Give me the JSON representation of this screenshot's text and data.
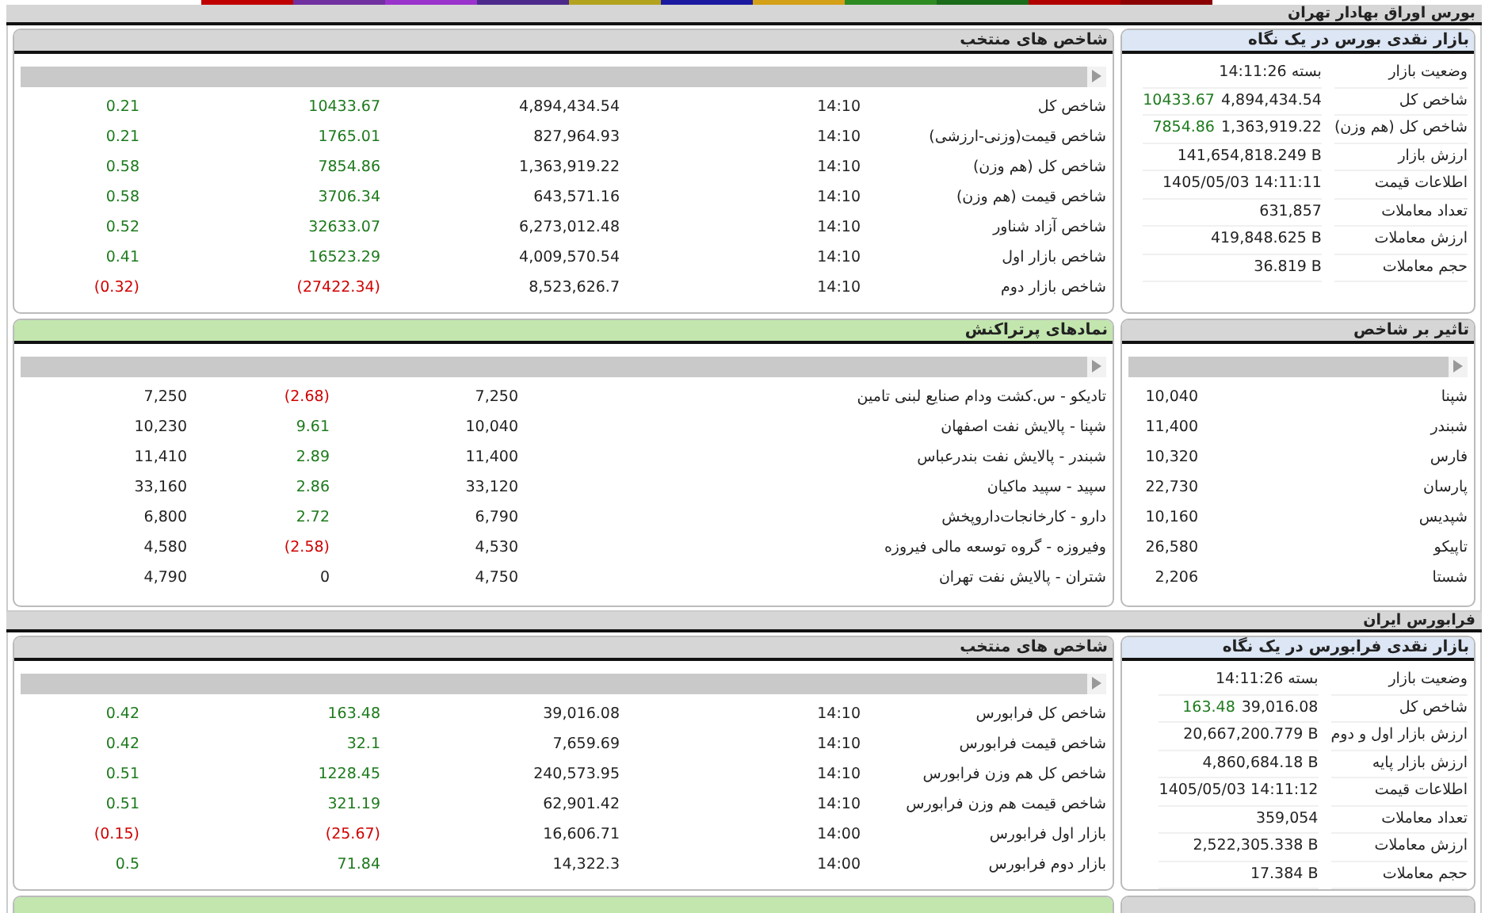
{
  "top_tabs": [
    {
      "color": "#c00000"
    },
    {
      "color": "#7030a0"
    },
    {
      "color": "#9933cc"
    },
    {
      "color": "#4b2a8c"
    },
    {
      "color": "#b3a21e"
    },
    {
      "color": "#1a1aa0"
    },
    {
      "color": "#d4a017"
    },
    {
      "color": "#2e8b22"
    },
    {
      "color": "#1a6b1a"
    },
    {
      "color": "#b00000"
    },
    {
      "color": "#8b0000"
    }
  ],
  "sections": [
    {
      "title": "بورس اوراق بهادار تهران",
      "panel_rows": [
        {
          "overview": {
            "kind": "summary",
            "header": {
              "title": "بازار نقدی بورس در یک نگاه",
              "color": "#dce6f4"
            },
            "rows": [
              {
                "label": "وضعیت بازار",
                "value": "بسته 14:11:26"
              },
              {
                "label": "شاخص کل",
                "value": "4,894,434.54",
                "change": "10433.67",
                "color": "#1d7a1d"
              },
              {
                "label": "شاخص کل (هم وزن)",
                "value": "1,363,919.22",
                "change": "7854.86",
                "color": "#1d7a1d"
              },
              {
                "label": "ارزش بازار",
                "value": "141,654,818.249 B"
              },
              {
                "label": "اطلاعات قیمت",
                "value": "1405/05/03 14:11:11"
              },
              {
                "label": "تعداد معاملات",
                "value": "631,857"
              },
              {
                "label": "ارزش معاملات",
                "value": "419,848.625 B"
              },
              {
                "label": "حجم معاملات",
                "value": "36.819 B"
              }
            ]
          },
          "main": {
            "kind": "index_table",
            "header": {
              "title": "شاخص های منتخب",
              "color": "#d6d6d6"
            },
            "rows": [
              {
                "cells": [
                  "شاخص کل",
                  "14:10",
                  "4,894,434.54",
                  "10433.67",
                  "0.21"
                ],
                "color": "#1d7a1d"
              },
              {
                "cells": [
                  "شاخص قیمت(وزنی-ارزشی)",
                  "14:10",
                  "827,964.93",
                  "1765.01",
                  "0.21"
                ],
                "color": "#1d7a1d"
              },
              {
                "cells": [
                  "شاخص کل (هم وزن)",
                  "14:10",
                  "1,363,919.22",
                  "7854.86",
                  "0.58"
                ],
                "color": "#1d7a1d"
              },
              {
                "cells": [
                  "شاخص قیمت (هم وزن)",
                  "14:10",
                  "643,571.16",
                  "3706.34",
                  "0.58"
                ],
                "color": "#1d7a1d"
              },
              {
                "cells": [
                  "شاخص آزاد شناور",
                  "14:10",
                  "6,273,012.48",
                  "32633.07",
                  "0.52"
                ],
                "color": "#1d7a1d"
              },
              {
                "cells": [
                  "شاخص بازار اول",
                  "14:10",
                  "4,009,570.54",
                  "16523.29",
                  "0.41"
                ],
                "color": "#1d7a1d"
              },
              {
                "cells": [
                  "شاخص بازار دوم",
                  "14:10",
                  "8,523,626.7",
                  "(27422.34)",
                  "(0.32)"
                ],
                "color": "#d00000"
              }
            ]
          }
        },
        {
          "overview": {
            "kind": "impact_table",
            "header": {
              "title": "تاثیر بر شاخص",
              "color": "#d6d6d6"
            },
            "rows": [
              {
                "cells": [
                  "شپنا",
                  "10,040"
                ]
              },
              {
                "cells": [
                  "شبندر",
                  "11,400"
                ]
              },
              {
                "cells": [
                  "فارس",
                  "10,320"
                ]
              },
              {
                "cells": [
                  "پارسان",
                  "22,730"
                ]
              },
              {
                "cells": [
                  "شپدیس",
                  "10,160"
                ]
              },
              {
                "cells": [
                  "تاپیکو",
                  "26,580"
                ]
              },
              {
                "cells": [
                  "شستا",
                  "2,206"
                ]
              }
            ]
          },
          "main": {
            "kind": "symbol_table",
            "header": {
              "title": "نمادهای پرتراکنش",
              "color": "#c2e6ae"
            },
            "rows": [
              {
                "cells": [
                  "تادیکو - س.کشت ودام صنایع لبنی تامین",
                  "7,250",
                  "(2.68)",
                  "7,250"
                ],
                "color": "#d00000"
              },
              {
                "cells": [
                  "شپنا - پالایش نفت اصفهان",
                  "10,040",
                  "9.61",
                  "10,230"
                ],
                "color": "#1d7a1d"
              },
              {
                "cells": [
                  "شبندر - پالایش نفت بندرعباس",
                  "11,400",
                  "2.89",
                  "11,410"
                ],
                "color": "#1d7a1d"
              },
              {
                "cells": [
                  "سپید - سپید ماکیان",
                  "33,120",
                  "2.86",
                  "33,160"
                ],
                "color": "#1d7a1d"
              },
              {
                "cells": [
                  "دارو - کارخانجات‌داروپخش",
                  "6,790",
                  "2.72",
                  "6,800"
                ],
                "color": "#1d7a1d"
              },
              {
                "cells": [
                  "وفیروزه - گروه توسعه مالی فیروزه",
                  "4,530",
                  "(2.58)",
                  "4,580"
                ],
                "color": "#d00000"
              },
              {
                "cells": [
                  "شتران - پالایش نفت تهران",
                  "4,750",
                  "0",
                  "4,790"
                ],
                "color": "#222222"
              }
            ]
          }
        }
      ]
    },
    {
      "title": "فرابورس ایران",
      "panel_rows": [
        {
          "overview": {
            "kind": "summary",
            "header": {
              "title": "بازار نقدی فرابورس در یک نگاه",
              "color": "#dce6f4"
            },
            "rows": [
              {
                "label": "وضعیت بازار",
                "value": "بسته 14:11:26"
              },
              {
                "label": "شاخص کل",
                "value": "39,016.08",
                "change": "163.48",
                "color": "#1d7a1d"
              },
              {
                "label": "ارزش بازار اول و دوم",
                "value": "20,667,200.779 B"
              },
              {
                "label": "ارزش بازار پایه",
                "value": "4,860,684.18 B"
              },
              {
                "label": "اطلاعات قیمت",
                "value": "1405/05/03 14:11:12"
              },
              {
                "label": "تعداد معاملات",
                "value": "359,054"
              },
              {
                "label": "ارزش معاملات",
                "value": "2,522,305.338 B"
              },
              {
                "label": "حجم معاملات",
                "value": "17.384 B"
              }
            ]
          },
          "main": {
            "kind": "index_table",
            "header": {
              "title": "شاخص های منتخب",
              "color": "#d6d6d6"
            },
            "rows": [
              {
                "cells": [
                  "شاخص کل فرابورس",
                  "14:10",
                  "39,016.08",
                  "163.48",
                  "0.42"
                ],
                "color": "#1d7a1d"
              },
              {
                "cells": [
                  "شاخص قیمت فرابورس",
                  "14:10",
                  "7,659.69",
                  "32.1",
                  "0.42"
                ],
                "color": "#1d7a1d"
              },
              {
                "cells": [
                  "شاخص کل هم وزن فرابورس",
                  "14:10",
                  "240,573.95",
                  "1228.45",
                  "0.51"
                ],
                "color": "#1d7a1d"
              },
              {
                "cells": [
                  "شاخص قیمت هم وزن فرابورس",
                  "14:10",
                  "62,901.42",
                  "321.19",
                  "0.51"
                ],
                "color": "#1d7a1d"
              },
              {
                "cells": [
                  "بازار اول فرابورس",
                  "14:00",
                  "16,606.71",
                  "(25.67)",
                  "(0.15)"
                ],
                "color": "#d00000"
              },
              {
                "cells": [
                  "بازار دوم فرابورس",
                  "14:00",
                  "14,322.3",
                  "71.84",
                  "0.5"
                ],
                "color": "#1d7a1d"
              }
            ]
          }
        },
        {
          "overview": {
            "kind": "stub",
            "header": {
              "color": "#d6d6d6"
            }
          },
          "main": {
            "kind": "stub",
            "header": {
              "color": "#c2e6ae"
            }
          }
        }
      ]
    }
  ]
}
